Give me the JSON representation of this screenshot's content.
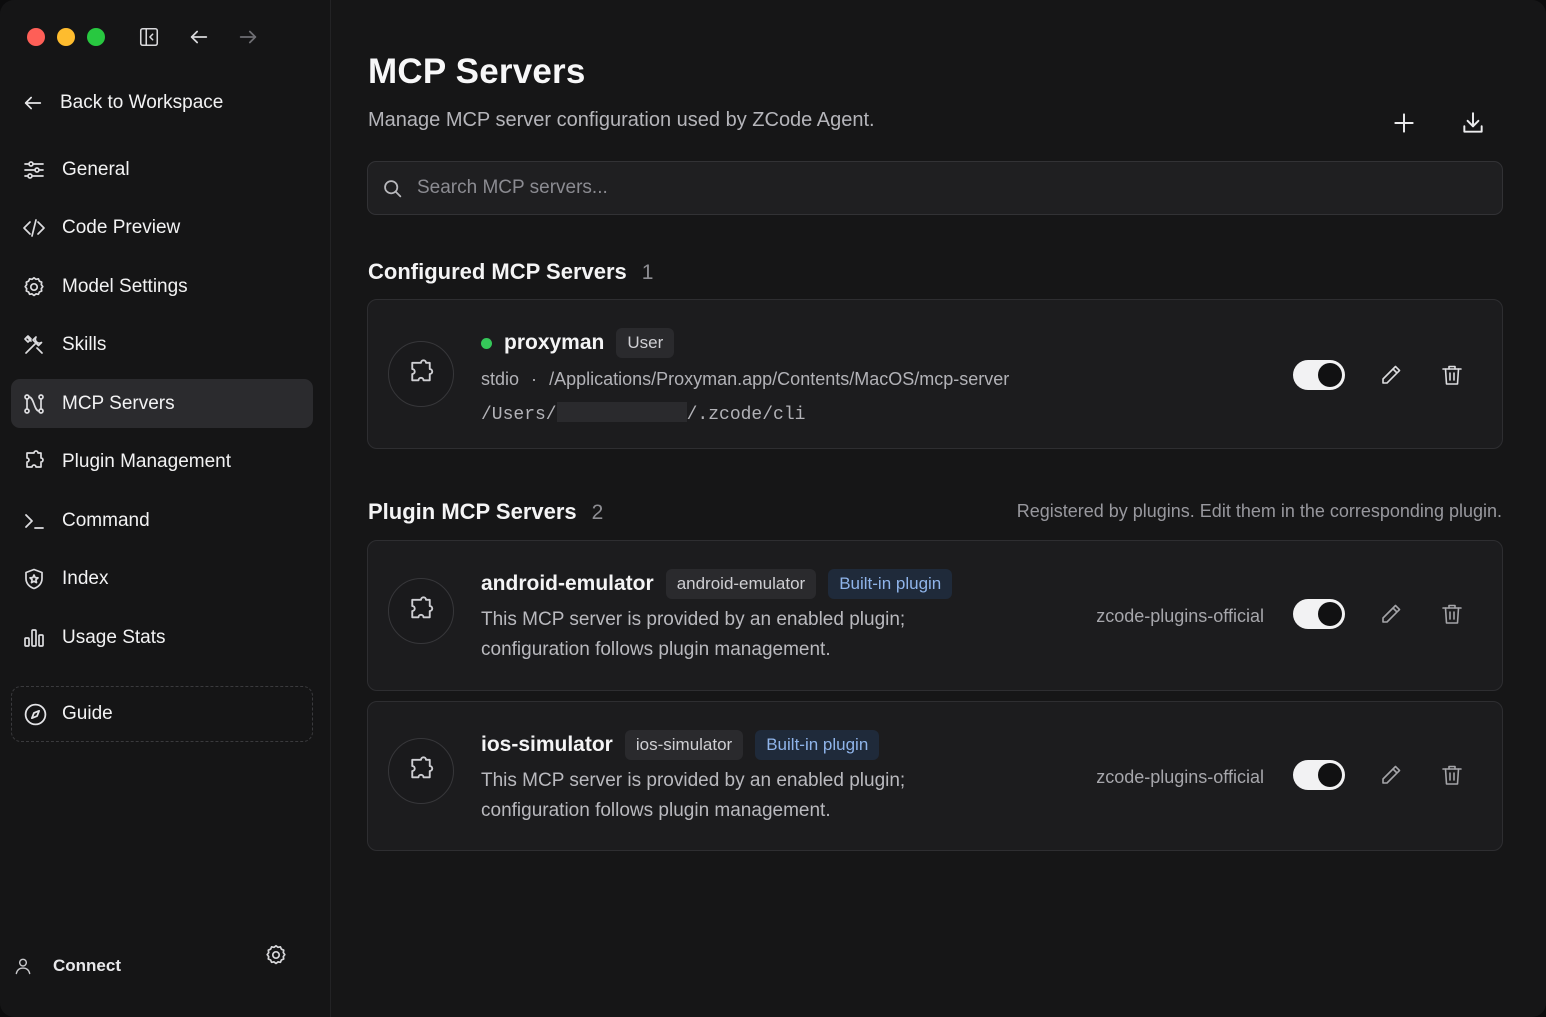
{
  "sidebar": {
    "back_label": "Back to Workspace",
    "items": [
      {
        "label": "General",
        "icon": "sliders-icon"
      },
      {
        "label": "Code Preview",
        "icon": "code-icon"
      },
      {
        "label": "Model Settings",
        "icon": "cog-icon"
      },
      {
        "label": "Skills",
        "icon": "tools-icon"
      },
      {
        "label": "MCP Servers",
        "icon": "mcp-icon",
        "active": true
      },
      {
        "label": "Plugin Management",
        "icon": "puzzle-icon"
      },
      {
        "label": "Command",
        "icon": "terminal-icon"
      },
      {
        "label": "Index",
        "icon": "shield-icon"
      },
      {
        "label": "Usage Stats",
        "icon": "bar-chart-icon"
      }
    ],
    "guide_label": "Guide",
    "connect_label": "Connect"
  },
  "header": {
    "title": "MCP Servers",
    "subtitle": "Manage MCP server configuration used by ZCode Agent."
  },
  "search": {
    "placeholder": "Search MCP servers..."
  },
  "configured": {
    "title": "Configured MCP Servers",
    "count": "1",
    "servers": [
      {
        "name": "proxyman",
        "tag": "User",
        "status_color": "#35c759",
        "transport": "stdio",
        "separator": "·",
        "command": "/Applications/Proxyman.app/Contents/MacOS/mcp-server",
        "cwd_prefix": "/Users/",
        "cwd_suffix": "/.zcode/cli",
        "enabled": true
      }
    ]
  },
  "plugins": {
    "title": "Plugin MCP Servers",
    "count": "2",
    "note": "Registered by plugins. Edit them in the corresponding plugin.",
    "servers": [
      {
        "name": "android-emulator",
        "tag": "android-emulator",
        "badge": "Built-in plugin",
        "desc_line1": "This MCP server is provided by an enabled plugin;",
        "desc_line2": "configuration follows plugin management.",
        "owner": "zcode-plugins-official",
        "enabled": true
      },
      {
        "name": "ios-simulator",
        "tag": "ios-simulator",
        "badge": "Built-in plugin",
        "desc_line1": "This MCP server is provided by an enabled plugin;",
        "desc_line2": "configuration follows plugin management.",
        "owner": "zcode-plugins-official",
        "enabled": true
      }
    ]
  },
  "colors": {
    "traffic_red": "#fe5f57",
    "traffic_yellow": "#febc2e",
    "traffic_green": "#28c840",
    "accent_badge": "#8fb4ea"
  }
}
